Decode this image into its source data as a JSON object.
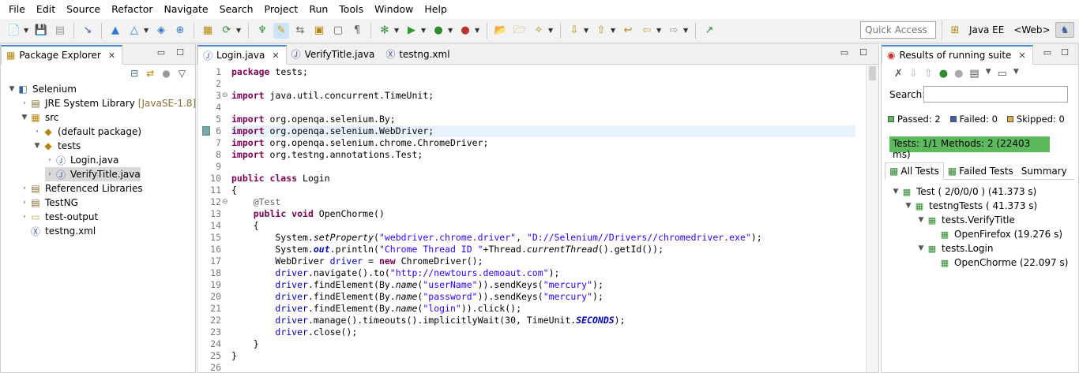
{
  "menu": [
    "File",
    "Edit",
    "Source",
    "Refactor",
    "Navigate",
    "Search",
    "Project",
    "Run",
    "Tools",
    "Window",
    "Help"
  ],
  "toolbar": {
    "quick_access": "Quick Access",
    "perspectives": [
      "Java EE",
      "<Web>"
    ]
  },
  "package_explorer": {
    "title": "Package Explorer",
    "tree": [
      {
        "label": "Selenium",
        "icon": "project-icon",
        "twisty": "open",
        "indent": 0
      },
      {
        "label": "JRE System Library",
        "decoration": "[JavaSE-1.8]",
        "icon": "library-icon",
        "twisty": "closed",
        "indent": 1
      },
      {
        "label": "src",
        "icon": "source-folder-icon",
        "twisty": "open",
        "indent": 1
      },
      {
        "label": "(default package)",
        "icon": "package-icon",
        "twisty": "closed",
        "indent": 2
      },
      {
        "label": "tests",
        "icon": "package-icon",
        "twisty": "open",
        "indent": 2
      },
      {
        "label": "Login.java",
        "icon": "java-file-icon",
        "twisty": "closed",
        "indent": 3
      },
      {
        "label": "VerifyTitle.java",
        "icon": "java-file-icon",
        "twisty": "closed",
        "indent": 3,
        "selected": true
      },
      {
        "label": "Referenced Libraries",
        "icon": "library-icon",
        "twisty": "closed",
        "indent": 1
      },
      {
        "label": "TestNG",
        "icon": "library-icon",
        "twisty": "closed",
        "indent": 1
      },
      {
        "label": "test-output",
        "icon": "folder-icon",
        "twisty": "closed",
        "indent": 1
      },
      {
        "label": "testng.xml",
        "icon": "xml-file-icon",
        "twisty": "none",
        "indent": 1
      }
    ]
  },
  "editor": {
    "tabs": [
      {
        "label": "Login.java",
        "active": true
      },
      {
        "label": "VerifyTitle.java",
        "active": false
      },
      {
        "label": "testng.xml",
        "active": false
      }
    ],
    "lines": [
      {
        "n": "1",
        "code": "<span class=\"kw\">package</span> tests;"
      },
      {
        "n": "2",
        "code": ""
      },
      {
        "n": "3",
        "code": "<span class=\"kw\">import</span> java.util.concurrent.TimeUnit;",
        "fold": true
      },
      {
        "n": "4",
        "code": ""
      },
      {
        "n": "5",
        "code": "<span class=\"kw\">import</span> org.openqa.selenium.By;"
      },
      {
        "n": "6",
        "code": "<span class=\"kw\">import</span> org.openqa.selenium.WebDriver;",
        "highlight": true,
        "bookmark": true
      },
      {
        "n": "7",
        "code": "<span class=\"kw\">import</span> org.openqa.selenium.chrome.ChromeDriver;"
      },
      {
        "n": "8",
        "code": "<span class=\"kw\">import</span> org.testng.annotations.Test;"
      },
      {
        "n": "9",
        "code": ""
      },
      {
        "n": "10",
        "code": "<span class=\"kw\">public class</span> Login"
      },
      {
        "n": "11",
        "code": "{"
      },
      {
        "n": "12",
        "code": "    <span class=\"ann\">@Test</span>",
        "fold": true
      },
      {
        "n": "13",
        "code": "    <span class=\"kw\">public void</span> OpenChorme()"
      },
      {
        "n": "14",
        "code": "    {"
      },
      {
        "n": "15",
        "code": "        System.<span class=\"it\">setProperty</span>(<span class=\"str\">\"webdriver.chrome.driver\"</span>, <span class=\"str\">\"D://Selenium//Drivers//chromedriver.exe\"</span>);"
      },
      {
        "n": "16",
        "code": "        System.<span class=\"fldit\">out</span>.println(<span class=\"str\">\"Chrome Thread ID \"</span>+Thread.<span class=\"it\">currentThread</span>().getId());"
      },
      {
        "n": "17",
        "code": "        WebDriver <span class=\"fld\">driver</span> = <span class=\"kw\">new</span> ChromeDriver();"
      },
      {
        "n": "18",
        "code": "        <span class=\"fld\">driver</span>.navigate().to(<span class=\"str\">\"http://newtours.demoaut.com\"</span>);"
      },
      {
        "n": "19",
        "code": "        <span class=\"fld\">driver</span>.findElement(By.<span class=\"it\">name</span>(<span class=\"str\">\"userName\"</span>)).sendKeys(<span class=\"str\">\"mercury\"</span>);"
      },
      {
        "n": "20",
        "code": "        <span class=\"fld\">driver</span>.findElement(By.<span class=\"it\">name</span>(<span class=\"str\">\"password\"</span>)).sendKeys(<span class=\"str\">\"mercury\"</span>);"
      },
      {
        "n": "21",
        "code": "        <span class=\"fld\">driver</span>.findElement(By.<span class=\"it\">name</span>(<span class=\"str\">\"login\"</span>)).click();"
      },
      {
        "n": "22",
        "code": "        <span class=\"fld\">driver</span>.manage().timeouts().implicitlyWait(30, TimeUnit.<span class=\"fldit\">SECONDS</span>);"
      },
      {
        "n": "23",
        "code": "        <span class=\"fld\">driver</span>.close();"
      },
      {
        "n": "24",
        "code": "    }"
      },
      {
        "n": "25",
        "code": "}"
      },
      {
        "n": "26",
        "code": ""
      }
    ]
  },
  "results": {
    "title": "Results of running suite",
    "search_label": "Search:",
    "search_value": "",
    "passed": "Passed: 2",
    "failed": "Failed: 0",
    "skipped": "Skipped: 0",
    "progress_text": "Tests: 1/1  Methods: 2 (22403 ms)",
    "progress_fraction": 1.0,
    "subtabs": [
      "All Tests",
      "Failed Tests",
      "Summary"
    ],
    "tree": [
      {
        "label": "Test ( 2/0/0/0 ) (41.373 s)",
        "indent": 0,
        "twisty": "open"
      },
      {
        "label": "testngTests ( 41.373 s)",
        "indent": 1,
        "twisty": "open"
      },
      {
        "label": "tests.VerifyTitle",
        "indent": 2,
        "twisty": "open"
      },
      {
        "label": "OpenFirefox  (19.276 s)",
        "indent": 3,
        "twisty": "none"
      },
      {
        "label": "tests.Login",
        "indent": 2,
        "twisty": "open"
      },
      {
        "label": "OpenChorme  (22.097 s)",
        "indent": 3,
        "twisty": "none"
      }
    ]
  },
  "colors": {
    "progress_pass": "#5cba5c",
    "keyword": "#7f0055",
    "string": "#2a00ff",
    "field": "#0000c0"
  }
}
